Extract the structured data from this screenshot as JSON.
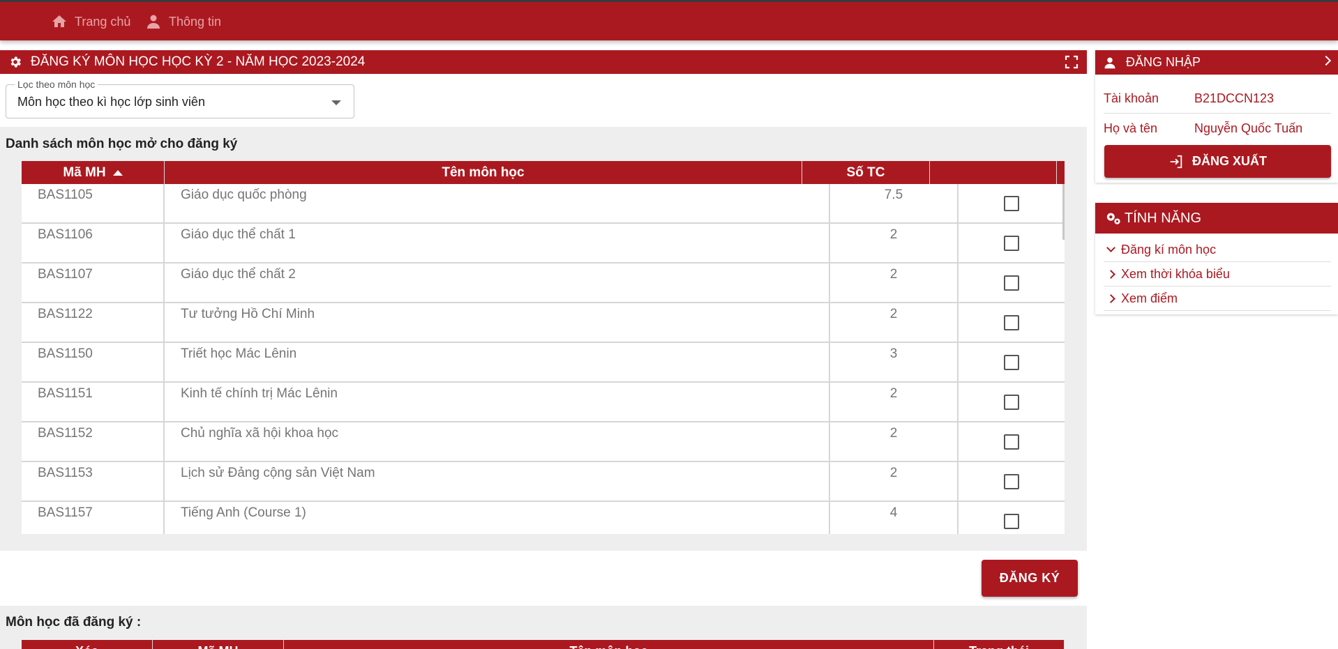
{
  "nav": {
    "home_label": "Trang chủ",
    "info_label": "Thông tin"
  },
  "main": {
    "title": "ĐĂNG KÝ MÔN HỌC HỌC KỲ 2 - NĂM HỌC 2023-2024",
    "filter": {
      "legend": "Lọc theo môn học",
      "value": "Môn học theo kì học lớp sinh viên"
    },
    "open_list_title": "Danh sách môn học mở cho đăng ký",
    "columns": {
      "code": "Mã MH",
      "name": "Tên môn học",
      "credits": "Số TC"
    },
    "courses": [
      {
        "code": "BAS1105",
        "name": "Giáo dục quốc phòng",
        "credits": "7.5"
      },
      {
        "code": "BAS1106",
        "name": "Giáo dục thể chất 1",
        "credits": "2"
      },
      {
        "code": "BAS1107",
        "name": "Giáo dục thể chất 2",
        "credits": "2"
      },
      {
        "code": "BAS1122",
        "name": "Tư tưởng Hồ Chí Minh",
        "credits": "2"
      },
      {
        "code": "BAS1150",
        "name": "Triết học Mác Lênin",
        "credits": "3"
      },
      {
        "code": "BAS1151",
        "name": "Kinh tế chính trị Mác Lênin",
        "credits": "2"
      },
      {
        "code": "BAS1152",
        "name": "Chủ nghĩa xã hội khoa học",
        "credits": "2"
      },
      {
        "code": "BAS1153",
        "name": "Lịch sử Đảng cộng sản Việt Nam",
        "credits": "2"
      },
      {
        "code": "BAS1157",
        "name": "Tiếng Anh (Course 1)",
        "credits": "4"
      }
    ],
    "register_button": "ĐĂNG KÝ",
    "registered_title": "Môn học đã đăng ký :",
    "registered_columns": {
      "delete": "Xóa",
      "code": "Mã MH",
      "name": "Tên môn học",
      "status": "Trạng thái"
    }
  },
  "login": {
    "header": "ĐĂNG NHẬP",
    "account_label": "Tài khoản",
    "account_value": "B21DCCN123",
    "name_label": "Họ và tên",
    "name_value": "Nguyễn Quốc Tuấn",
    "logout_button": "ĐĂNG XUẤT"
  },
  "features": {
    "header": "TÍNH NĂNG",
    "items": [
      "Đăng kí môn học",
      "Xem thời khóa biểu",
      "Xem điểm"
    ]
  },
  "colors": {
    "brand": "#ab1920",
    "background_grey": "#eeeeee"
  }
}
